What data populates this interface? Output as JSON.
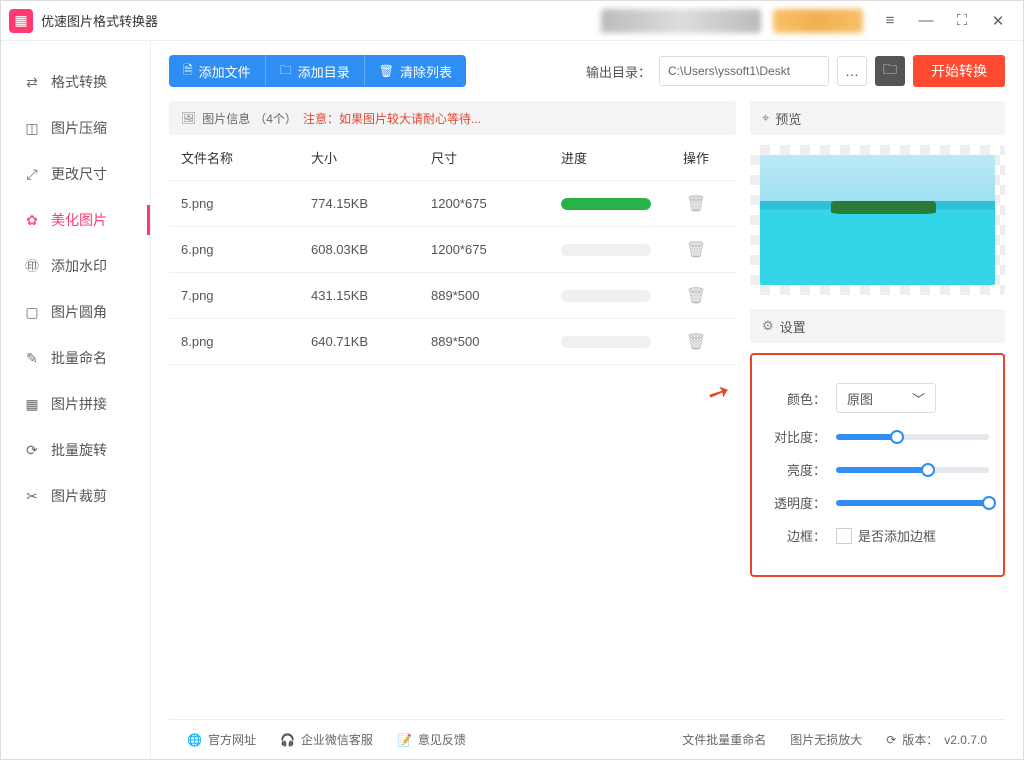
{
  "app": {
    "title": "优速图片格式转换器"
  },
  "sidebar": {
    "items": [
      {
        "label": "格式转换",
        "icon": "⇄"
      },
      {
        "label": "图片压缩",
        "icon": "◫"
      },
      {
        "label": "更改尺寸",
        "icon": "⤢"
      },
      {
        "label": "美化图片",
        "icon": "✿"
      },
      {
        "label": "添加水印",
        "icon": "㊞"
      },
      {
        "label": "图片圆角",
        "icon": "▢"
      },
      {
        "label": "批量命名",
        "icon": "✎"
      },
      {
        "label": "图片拼接",
        "icon": "▦"
      },
      {
        "label": "批量旋转",
        "icon": "⟳"
      },
      {
        "label": "图片裁剪",
        "icon": "✂"
      }
    ],
    "active_index": 3
  },
  "toolbar": {
    "add_file": "添加文件",
    "add_dir": "添加目录",
    "clear": "清除列表",
    "outdir_label": "输出目录：",
    "outdir_value": "C:\\Users\\yssoft1\\Deskt",
    "start": "开始转换"
  },
  "info": {
    "label": "图片信息",
    "count": "（4个）",
    "warn": "注意：如果图片较大请耐心等待..."
  },
  "table": {
    "headers": {
      "name": "文件名称",
      "size": "大小",
      "dim": "尺寸",
      "prog": "进度",
      "act": "操作"
    },
    "rows": [
      {
        "name": "5.png",
        "size": "774.15KB",
        "dim": "1200*675",
        "done": true
      },
      {
        "name": "6.png",
        "size": "608.03KB",
        "dim": "1200*675",
        "done": false
      },
      {
        "name": "7.png",
        "size": "431.15KB",
        "dim": "889*500",
        "done": false
      },
      {
        "name": "8.png",
        "size": "640.71KB",
        "dim": "889*500",
        "done": false
      }
    ]
  },
  "preview": {
    "title": "预览"
  },
  "settings": {
    "title": "设置",
    "color_label": "颜色：",
    "color_value": "原图",
    "contrast_label": "对比度：",
    "contrast_pct": 40,
    "brightness_label": "亮度：",
    "brightness_pct": 60,
    "opacity_label": "透明度：",
    "opacity_pct": 100,
    "border_label": "边框：",
    "border_check": "是否添加边框"
  },
  "footer": {
    "site": "官方网址",
    "service": "企业微信客服",
    "feedback": "意见反馈",
    "rename": "文件批量重命名",
    "zoom": "图片无损放大",
    "version_label": "版本：",
    "version_value": "v2.0.7.0"
  }
}
